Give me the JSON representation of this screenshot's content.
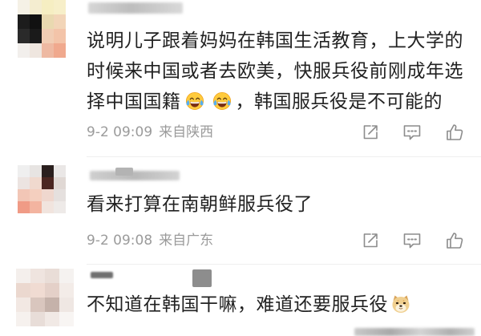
{
  "comments": [
    {
      "body_before_emoji": "说明儿子跟着妈妈在韩国生活教育，上大学的时候来中国或者去欧美，快服兵役前刚成年选择中国国籍",
      "emojis": [
        "tears-of-joy-icon",
        "tears-of-joy-icon"
      ],
      "body_after_emoji": "，韩国服兵役是不可能的",
      "time": "9-2 09:09",
      "location": "来自陕西"
    },
    {
      "body": "看来打算在南朝鲜服兵役了",
      "time": "9-2 09:08",
      "location": "来自广东"
    },
    {
      "body_before_emoji": "不知道在韩国干嘛，难道还要服兵役",
      "emojis": [
        "doge-icon"
      ]
    }
  ],
  "actions": {
    "share_icon": "share-icon",
    "comment_icon": "comment-icon",
    "like_icon": "thumbs-up-icon"
  },
  "colors": {
    "text": "#222222",
    "meta": "#9b9b9b",
    "icon": "#8c8c8c",
    "background": "#ffffff"
  }
}
